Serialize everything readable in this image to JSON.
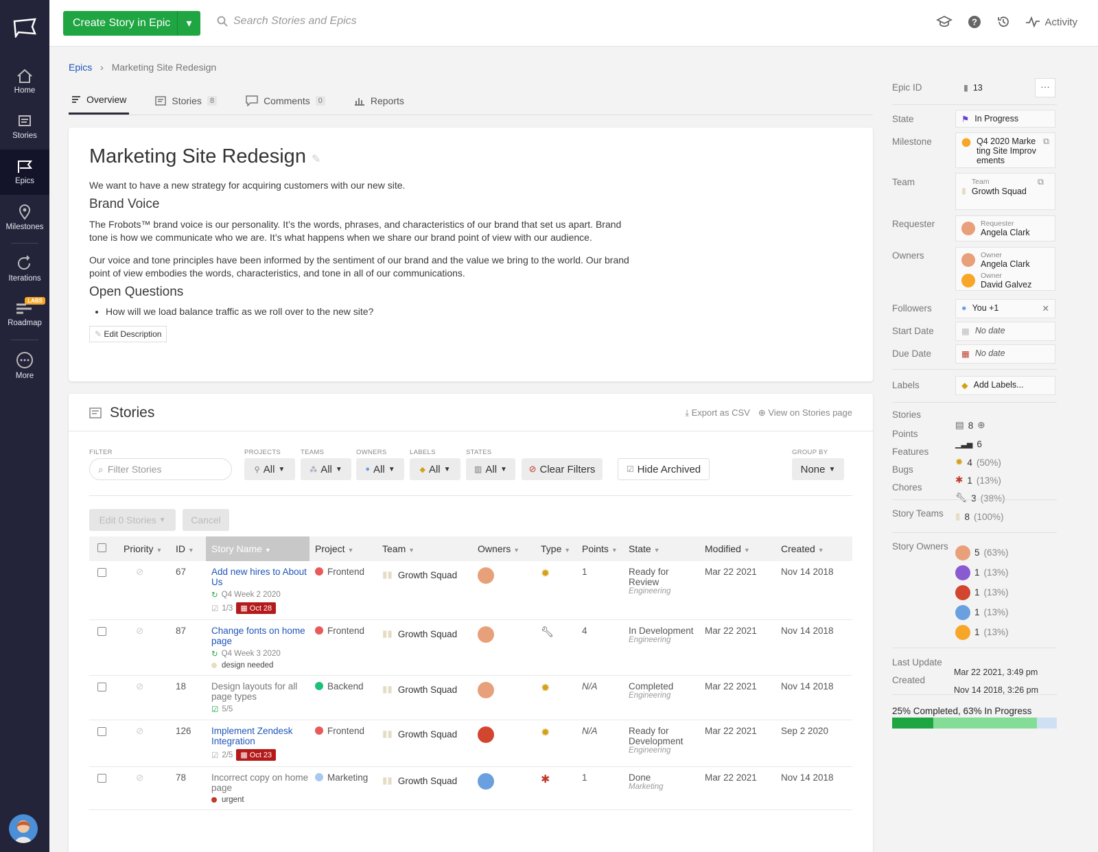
{
  "nav": {
    "items": [
      {
        "label": "Home"
      },
      {
        "label": "Stories"
      },
      {
        "label": "Epics"
      },
      {
        "label": "Milestones"
      },
      {
        "label": "Iterations"
      },
      {
        "label": "Roadmap",
        "badge": "LABS"
      },
      {
        "label": "More"
      }
    ]
  },
  "top": {
    "create_label": "Create Story in Epic",
    "search_placeholder": "Search Stories and Epics",
    "activity": "Activity"
  },
  "breadcrumb": {
    "root": "Epics",
    "current": "Marketing Site Redesign"
  },
  "tabs": [
    {
      "label": "Overview"
    },
    {
      "label": "Stories",
      "count": "8"
    },
    {
      "label": "Comments",
      "count": "0"
    },
    {
      "label": "Reports"
    }
  ],
  "epic": {
    "title": "Marketing Site Redesign",
    "intro": "We want to have a new strategy for acquiring customers with our new site.",
    "h_brand": "Brand Voice",
    "p1": "The Frobots™ brand voice is our personality. It’s the words, phrases, and characteristics of our brand that set us apart. Brand tone is how we communicate who we are. It’s what happens when we share our brand point of view with our audience.",
    "p2": "Our voice and tone principles have been informed by the sentiment of our brand and the value we bring to the world. Our brand point of view embodies the words, characteristics, and tone in all of our communications.",
    "h_open": "Open Questions",
    "q1": "How will we load balance traffic as we roll over to the new site?",
    "edit": "Edit Description"
  },
  "stories": {
    "title": "Stories",
    "export": "Export as CSV",
    "view": "View on Stories page",
    "filters": {
      "filter_label": "FILTER",
      "filter_placeholder": "Filter Stories",
      "projects": "PROJECTS",
      "teams": "TEAMS",
      "owners": "OWNERS",
      "labels": "LABELS",
      "states": "STATES",
      "all": "All",
      "clear": "Clear Filters",
      "hide": "Hide Archived",
      "group_label": "GROUP BY",
      "group_value": "None"
    },
    "edit_btn": "Edit 0 Stories",
    "cancel_btn": "Cancel",
    "columns": [
      "Priority",
      "ID",
      "Story Name",
      "Project",
      "Team",
      "Owners",
      "Type",
      "Points",
      "State",
      "Modified",
      "Created"
    ],
    "rows": [
      {
        "id": "67",
        "name": "Add new hires to About Us",
        "meta1": "Q4 Week 2 2020",
        "meta2": "1/3",
        "due": "Oct 28",
        "project": "Frontend",
        "pcolor": "#e85a5a",
        "team": "Growth Squad",
        "type": "feature",
        "points": "1",
        "state": "Ready for Review",
        "workflow": "Engineering",
        "modified": "Mar 22 2021",
        "created": "Nov 14 2018",
        "link": true,
        "avatar": "#e8a07a"
      },
      {
        "id": "87",
        "name": "Change fonts on home page",
        "meta1": "Q4 Week 3 2020",
        "label": "design needed",
        "lcolor": "#eadcc0",
        "project": "Frontend",
        "pcolor": "#e85a5a",
        "team": "Growth Squad",
        "type": "chore",
        "points": "4",
        "state": "In Development",
        "workflow": "Engineering",
        "modified": "Mar 22 2021",
        "created": "Nov 14 2018",
        "link": true,
        "avatar": "#e8a07a"
      },
      {
        "id": "18",
        "name": "Design layouts for all page types",
        "meta2": "5/5",
        "project": "Backend",
        "pcolor": "#1ec07a",
        "team": "Growth Squad",
        "type": "feature",
        "points": "N/A",
        "state": "Completed",
        "workflow": "Engineering",
        "modified": "Mar 22 2021",
        "created": "Nov 14 2018",
        "link": false,
        "avatar": "#e8a07a"
      },
      {
        "id": "126",
        "name": "Implement Zendesk Integration",
        "meta2": "2/5",
        "due": "Oct 23",
        "project": "Frontend",
        "pcolor": "#e85a5a",
        "team": "Growth Squad",
        "type": "feature",
        "points": "N/A",
        "state": "Ready for Development",
        "workflow": "Engineering",
        "modified": "Mar 22 2021",
        "created": "Sep 2 2020",
        "link": true,
        "avatar": "#d2452f"
      },
      {
        "id": "78",
        "name": "Incorrect copy on home page",
        "label": "urgent",
        "lcolor": "#c0392b",
        "project": "Marketing",
        "pcolor": "#a8c8f0",
        "team": "Growth Squad",
        "type": "bug",
        "points": "1",
        "state": "Done",
        "workflow": "Marketing",
        "modified": "Mar 22 2021",
        "created": "Nov 14 2018",
        "link": false,
        "avatar": "#6aa0e0"
      }
    ]
  },
  "side": {
    "epic_id_label": "Epic ID",
    "epic_id": "13",
    "state_label": "State",
    "state": "In Progress",
    "milestone_label": "Milestone",
    "milestone": "Q4 2020 Marketing Site Improvements",
    "team_label": "Team",
    "team_tiny": "Team",
    "team": "Growth Squad",
    "req_label": "Requester",
    "req_tiny": "Requester",
    "req": "Angela Clark",
    "owners_label": "Owners",
    "owner_tiny": "Owner",
    "owner1": "Angela Clark",
    "owner2": "David Galvez",
    "followers_label": "Followers",
    "followers": "You +1",
    "start_label": "Start Date",
    "start": "No date",
    "due_label": "Due Date",
    "due": "No date",
    "labels_label": "Labels",
    "labels": "Add Labels...",
    "stats": [
      {
        "label": "Stories",
        "value": "8",
        "pct": ""
      },
      {
        "label": "Points",
        "value": "6",
        "pct": ""
      },
      {
        "label": "Features",
        "value": "4",
        "pct": "(50%)"
      },
      {
        "label": "Bugs",
        "value": "1",
        "pct": "(13%)"
      },
      {
        "label": "Chores",
        "value": "3",
        "pct": "(38%)"
      }
    ],
    "teams_label": "Story Teams",
    "teams_value": "8",
    "teams_pct": "(100%)",
    "owners_stat_label": "Story Owners",
    "owner_stats": [
      {
        "v": "5",
        "p": "(63%)",
        "c": "#e8a07a"
      },
      {
        "v": "1",
        "p": "(13%)",
        "c": "#8a5ad0"
      },
      {
        "v": "1",
        "p": "(13%)",
        "c": "#d2452f"
      },
      {
        "v": "1",
        "p": "(13%)",
        "c": "#6aa0e0"
      },
      {
        "v": "1",
        "p": "(13%)",
        "c": "#f7a628"
      }
    ],
    "last_update_label": "Last Update",
    "last_update": "Mar 22 2021, 3:49 pm",
    "created_label": "Created",
    "created": "Nov 14 2018, 3:26 pm",
    "progress_text": "25% Completed, 63% In Progress",
    "progress": {
      "completed": 0.25,
      "in_progress": 0.63
    }
  },
  "colors": {
    "green": "#1fa542",
    "nav": "#23233a",
    "link": "#1e55b8"
  }
}
